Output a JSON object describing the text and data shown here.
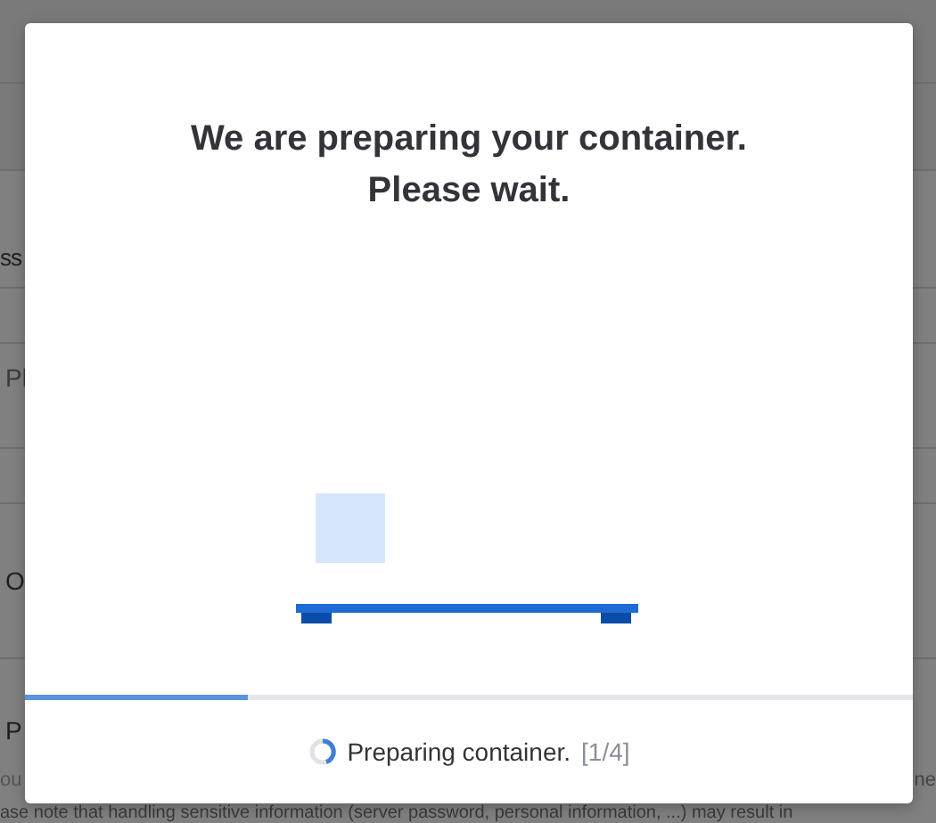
{
  "background": {
    "rows": [
      "ss",
      "Pl",
      "O",
      "P"
    ],
    "hint": "ou",
    "hint_end": "ne",
    "note": "ase note that handling sensitive information (server password, personal information, ...) may result in"
  },
  "modal": {
    "title_lines": [
      "We are preparing your container.",
      "Please wait."
    ],
    "progress": {
      "level": 0.25
    },
    "status": {
      "text": "Preparing container.",
      "step": "[1/4]"
    }
  }
}
